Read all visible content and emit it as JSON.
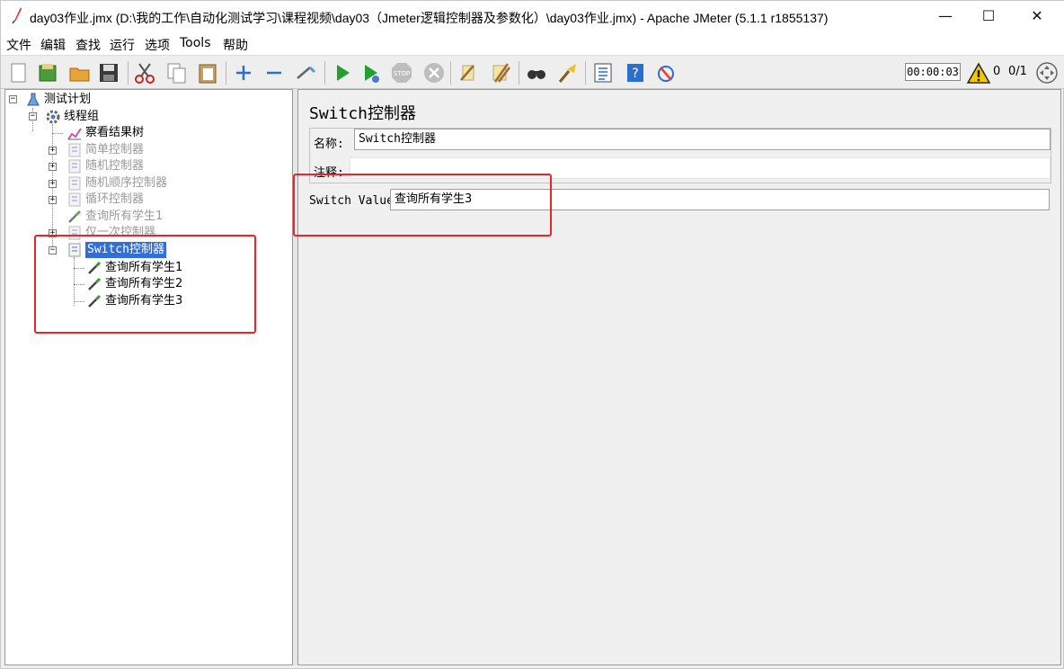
{
  "window": {
    "title": "day03作业.jmx (D:\\我的工作\\自动化测试学习\\课程视频\\day03（Jmeter逻辑控制器及参数化）\\day03作业.jmx) - Apache JMeter (5.1.1 r1855137)",
    "minimize": "—",
    "maximize": "☐",
    "close": "✕"
  },
  "menu": [
    "文件",
    "编辑",
    "查找",
    "运行",
    "选项",
    "Tools",
    "帮助"
  ],
  "toolbar": {
    "icons": [
      "new-icon",
      "templates-icon",
      "open-icon",
      "save-icon",
      "cut-icon",
      "copy-icon",
      "paste-icon",
      "expand-icon",
      "collapse-icon",
      "toggle-icon",
      "start-icon",
      "start-no-pause-icon",
      "stop-icon",
      "shutdown-icon",
      "clear-icon",
      "clear-all-icon",
      "search-icon",
      "reset-search-icon",
      "function-helper-icon",
      "help-icon",
      "remote-icon"
    ],
    "timer": "00:00:03",
    "warnings": "0",
    "threads": "0/1"
  },
  "tree": [
    {
      "label": "测试计划",
      "state": "normal"
    },
    {
      "label": "线程组",
      "state": "normal"
    },
    {
      "label": "察看结果树",
      "state": "normal"
    },
    {
      "label": "简单控制器",
      "state": "disabled"
    },
    {
      "label": "随机控制器",
      "state": "disabled"
    },
    {
      "label": "随机顺序控制器",
      "state": "disabled"
    },
    {
      "label": "循环控制器",
      "state": "disabled"
    },
    {
      "label": "查询所有学生1",
      "state": "disabled"
    },
    {
      "label": "仅一次控制器",
      "state": "disabled"
    },
    {
      "label": "Switch控制器",
      "state": "selected"
    },
    {
      "label": "查询所有学生1",
      "state": "normal"
    },
    {
      "label": "查询所有学生2",
      "state": "normal"
    },
    {
      "label": "查询所有学生3",
      "state": "normal"
    }
  ],
  "panel": {
    "title": "Switch控制器",
    "name_label": "名称:",
    "name_value": "Switch控制器",
    "comment_label": "注释:",
    "comment_value": "",
    "switch_label": "Switch Value",
    "switch_value": "查询所有学生3"
  },
  "colors": {
    "annotation": "#e5262b",
    "selection": "#2f6fd6"
  }
}
